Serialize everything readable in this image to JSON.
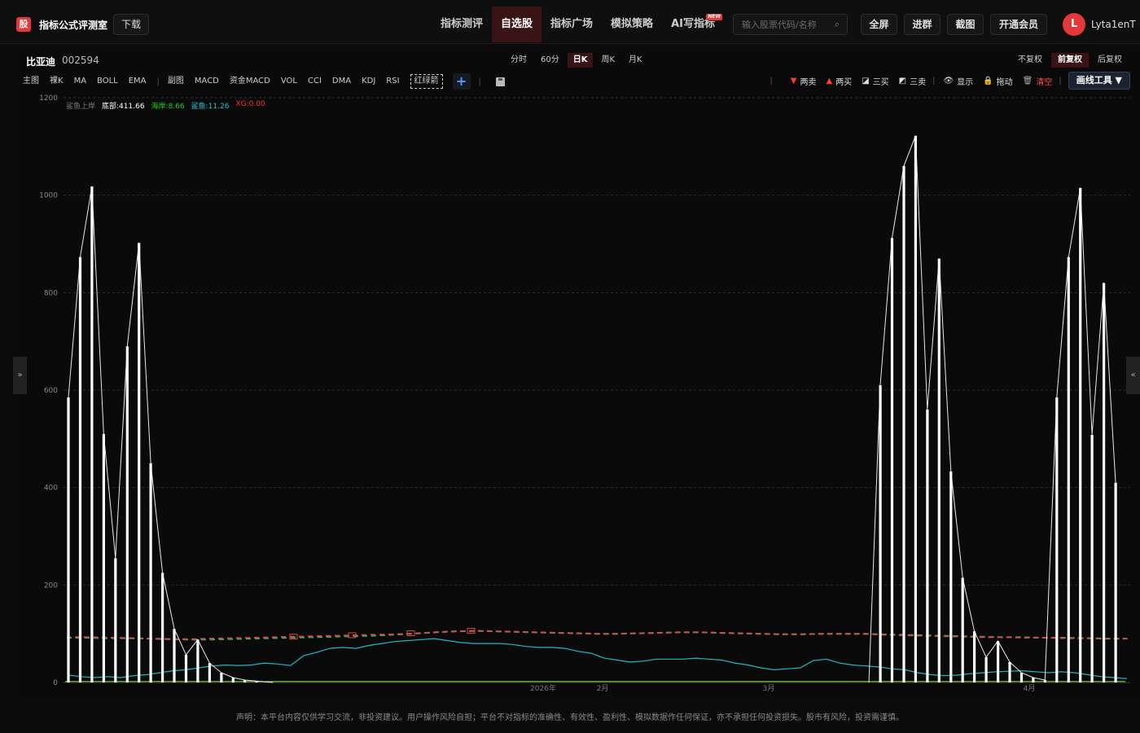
{
  "app": {
    "logo": "股",
    "title": "指标公式评测室",
    "download": "下载"
  },
  "nav": [
    {
      "label": "指标测评",
      "active": false
    },
    {
      "label": "自选股",
      "active": true
    },
    {
      "label": "指标广场",
      "active": false
    },
    {
      "label": "模拟策略",
      "active": false
    },
    {
      "label": "AI写指标",
      "active": false,
      "badge": "NEW"
    }
  ],
  "search": {
    "placeholder": "输入股票代码/名称",
    "icon": "search-icon"
  },
  "top_buttons": [
    "全屏",
    "进群",
    "截图",
    "开通会员"
  ],
  "user": {
    "avatar": "L",
    "name": "Lyta1enT"
  },
  "stock": {
    "name": "比亚迪",
    "code": "002594"
  },
  "periods": [
    {
      "label": "分时",
      "active": false
    },
    {
      "label": "60分",
      "active": false
    },
    {
      "label": "日K",
      "active": true
    },
    {
      "label": "周K",
      "active": false
    },
    {
      "label": "月K",
      "active": false
    }
  ],
  "adjust": [
    {
      "label": "不复权",
      "active": false
    },
    {
      "label": "前复权",
      "active": true
    },
    {
      "label": "后复权",
      "active": false
    }
  ],
  "indicators_main": [
    "主图",
    "裸K",
    "MA",
    "BOLL",
    "EMA"
  ],
  "indicators_sub": [
    "副图",
    "MACD",
    "资金MACD",
    "VOL",
    "CCI",
    "DMA",
    "KDJ",
    "RSI"
  ],
  "indicator_boxed": "红绿箭",
  "tools": [
    {
      "label": "两卖",
      "icon": "triangle-down-icon",
      "color": "#ff3b30"
    },
    {
      "label": "两买",
      "icon": "triangle-up-icon",
      "color": "#ff3b30"
    },
    {
      "label": "三买",
      "icon": "chart-up-icon",
      "color": "#ddd"
    },
    {
      "label": "三卖",
      "icon": "chart-down-icon",
      "color": "#ddd"
    },
    {
      "label": "显示",
      "icon": "eye-icon",
      "color": "#ddd"
    },
    {
      "label": "拖动",
      "icon": "lock-icon",
      "color": "#ddd"
    },
    {
      "label": "清空",
      "icon": "trash-icon",
      "color": "#ff4d4f"
    }
  ],
  "draw_tools": "画线工具 ▼",
  "legend": [
    {
      "label": "鲨鱼上岸",
      "color": "#777777"
    },
    {
      "label": "底部:411.66",
      "color": "#ffffff"
    },
    {
      "label": "海岸:8.66",
      "color": "#22cc22"
    },
    {
      "label": "鲨鱼:11.26",
      "color": "#22c5d8"
    },
    {
      "label": "XG:0.00",
      "color": "#ff3333"
    }
  ],
  "side_tabs": {
    "left": "»",
    "right": "«"
  },
  "footer": "声明：本平台内容仅供学习交流，非投资建议。用户操作风险自担；平台不对指标的准确性、有效性、盈利性、模拟数据作任何保证，亦不承担任何投资损失。股市有风险，投资需谨慎。",
  "chart_data": {
    "type": "bar",
    "title": "",
    "ylim": [
      0,
      1200
    ],
    "yticks": [
      0,
      200,
      400,
      600,
      800,
      1000,
      1200
    ],
    "xticks": [
      "2026年",
      "2月",
      "3月",
      "4月"
    ],
    "grid": true,
    "bars_left": [
      585,
      873,
      1018,
      510,
      255,
      690,
      902,
      450,
      225,
      110,
      57,
      88,
      40,
      20,
      10,
      5,
      3
    ],
    "bars_right": [
      610,
      912,
      1060,
      1122,
      560,
      870,
      433,
      215,
      105,
      52,
      85,
      42,
      20,
      10,
      5,
      585,
      873,
      1015,
      508,
      820,
      410
    ],
    "teal_line": [
      15,
      12,
      10,
      12,
      10,
      14,
      16,
      20,
      24,
      26,
      30,
      34,
      36,
      35,
      36,
      40,
      38,
      35,
      55,
      62,
      70,
      72,
      70,
      76,
      80,
      84,
      86,
      88,
      90,
      86,
      82,
      80,
      80,
      80,
      78,
      74,
      72,
      72,
      70,
      64,
      60,
      50,
      46,
      42,
      44,
      48,
      48,
      48,
      50,
      48,
      46,
      40,
      36,
      30,
      26,
      28,
      30,
      45,
      48,
      40,
      36,
      34,
      32,
      28,
      26,
      20,
      16,
      14,
      15,
      18,
      20,
      22,
      23,
      24,
      22,
      20,
      22,
      20,
      16,
      12,
      10,
      8
    ],
    "green_line": [
      92,
      92,
      91,
      91,
      90,
      89,
      88,
      88,
      89,
      90,
      91,
      92,
      93,
      94,
      95,
      96,
      98,
      100,
      103,
      105,
      106,
      105,
      104,
      103,
      102,
      101,
      100,
      100,
      101,
      102,
      103,
      103,
      102,
      101,
      100,
      99,
      99,
      100,
      100,
      100,
      99,
      98,
      97,
      96,
      95,
      94,
      93,
      93,
      92,
      92,
      91,
      90,
      90
    ],
    "red_line": [
      93,
      93,
      92,
      91,
      90,
      89,
      89,
      90,
      91,
      92,
      93,
      94,
      95,
      96,
      97,
      98,
      99,
      101,
      103,
      105,
      106,
      105,
      104,
      103,
      102,
      101,
      100,
      100,
      101,
      102,
      103,
      103,
      102,
      101,
      100,
      99,
      99,
      100,
      100,
      100,
      98,
      97,
      96,
      95,
      94,
      93,
      93,
      92,
      92,
      91,
      91,
      90,
      90
    ]
  }
}
